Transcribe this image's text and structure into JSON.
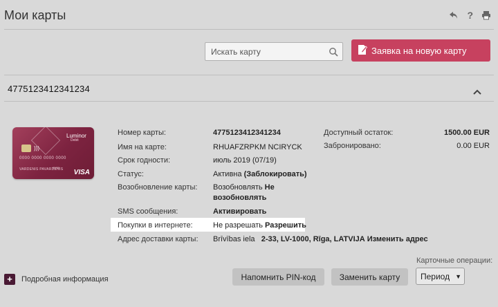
{
  "header": {
    "title": "Мои карты",
    "icons": [
      "back-arrow-icon",
      "help-icon",
      "print-icon"
    ],
    "help_glyph": "?"
  },
  "toolbar": {
    "search_placeholder": "Искать карту",
    "new_card_label": "Заявка на новую карту",
    "accent_color": "#c7415f"
  },
  "account": {
    "number": "4775123412341234"
  },
  "card_image": {
    "brand": "Luminor",
    "brand_sub": "Debit",
    "number_text": "0000 0000 0000 0000",
    "name_text": "VARDENIS PAVARDENIS",
    "valid_text": "00/00",
    "network": "VISA"
  },
  "details": {
    "card_number_label": "Номер карты:",
    "card_number_value": "4775123412341234",
    "name_label": "Имя на карте:",
    "name_value": "RHUAFZRPKM NCIRYCK",
    "expiry_label": "Срок годности:",
    "expiry_value": "июль 2019 (07/19)",
    "status_label": "Статус:",
    "status_value": "Активна",
    "status_action": "(Заблокировать)",
    "renewal_label": "Возобновление карты:",
    "renewal_value": "Возобновлять",
    "renewal_action_1": "Не",
    "renewal_action_2": "возобновлять",
    "sms_label": "SMS сообщения:",
    "sms_action": "Активировать",
    "internet_label": "Покупки в интернете:",
    "internet_value": "Не разрешать",
    "internet_action": "Разрешить",
    "address_label": "Адрес доставки карты:",
    "address_street": "Brīvības iela",
    "address_rest": "2-33, LV-1000, Rīga, LATVIJA",
    "address_action": "Изменить адрес"
  },
  "balance": {
    "available_label": "Доступный остаток:",
    "available_value": "1500.00 EUR",
    "reserved_label": "Забронировано:",
    "reserved_value": "0.00 EUR"
  },
  "footer": {
    "more_info_glyph": "+",
    "more_info_label": "Подробная информация",
    "remind_pin_label": "Напомнить PIN-код",
    "replace_card_label": "Заменить карту",
    "operations_label": "Карточные операции:",
    "period_selected": "Период",
    "period_caret": "▼"
  }
}
